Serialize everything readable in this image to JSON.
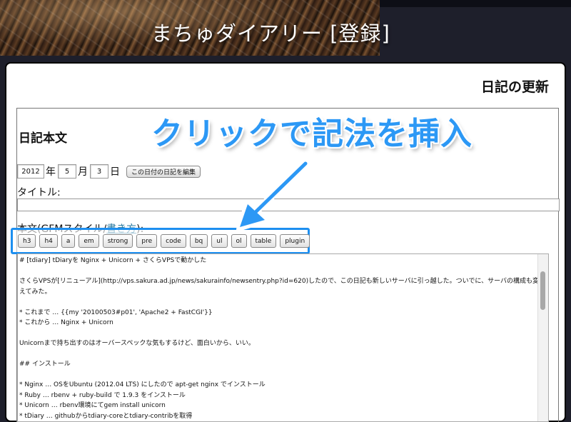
{
  "site": {
    "title": "まちゅダイアリー [登録]"
  },
  "page": {
    "heading": "日記の更新"
  },
  "form": {
    "section_title": "日記本文",
    "year": "2012",
    "year_unit": "年",
    "month": "5",
    "month_unit": "月",
    "day": "3",
    "day_unit": "日",
    "edit_date_button": "この日付の日記を編集",
    "title_label": "タイトル:",
    "title_value": "",
    "body_label_prefix": "本文(GFMスタイル/",
    "body_label_link": "書き方",
    "body_label_suffix": "):"
  },
  "toolbar": {
    "buttons": [
      "h3",
      "h4",
      "a",
      "em",
      "strong",
      "pre",
      "code",
      "bq",
      "ul",
      "ol",
      "table",
      "plugin"
    ]
  },
  "editor": {
    "lines": [
      "# [tdiary] tDiaryを Nginx + Unicorn + さくらVPSで動かした",
      "",
      "さくらVPSが[リニューアル](http://vps.sakura.ad.jp/news/sakurainfo/newsentry.php?id=620)したので、この日記も新しいサーバに引っ越した。ついでに、サーバの構成も変えてみた。",
      "",
      " * これまで … {{my '20100503#p01', 'Apache2 + FastCGI'}}",
      " * これから … Nginx + Unicorn",
      "",
      "Unicornまで持ち出すのはオーバースペックな気もするけど、面白いから、いい。",
      "",
      "## インストール",
      "",
      " * Nginx … OSをUbuntu (2012.04 LTS) にしたので apt-get nginx でインストール",
      " * Ruby … rbenv + ruby-build で 1.9.3 をインストール",
      " * Unicorn … rbenv環境にてgem install unicorn",
      " * tDiary … githubからtdiary-coreとtdiary-contribを取得"
    ]
  },
  "annotation": {
    "text": "クリックで記法を挿入",
    "color": "#2c98f5"
  }
}
